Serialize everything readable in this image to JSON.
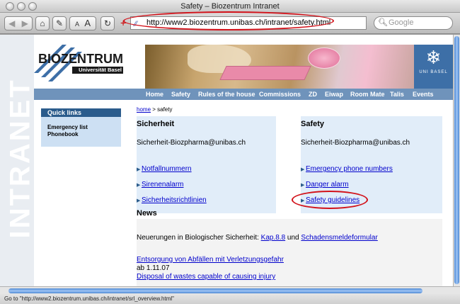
{
  "window": {
    "title": "Safety – Biozentrum Intranet"
  },
  "toolbar": {
    "back_icon": "back-arrow-icon",
    "forward_icon": "forward-arrow-icon",
    "text_smaller": "A",
    "text_bigger": "A",
    "url": "http://www2.biozentrum.unibas.ch/intranet/safety.html",
    "add_bookmark": "+",
    "search_placeholder": "Google"
  },
  "header": {
    "logo_word": "BIOZENTRUM",
    "logo_sub": "Universität Basel",
    "unibas_logo_text": "UNI BASEL",
    "side_text": "INTRANET"
  },
  "nav": {
    "items": [
      "Home",
      "Safety",
      "Rules of the house",
      "Commissions",
      "ZD",
      "Eiwap",
      "Room Mate",
      "Talis",
      "Events"
    ]
  },
  "quick_links": {
    "title": "Quick links",
    "items": [
      "Emergency list",
      "Phonebook"
    ]
  },
  "breadcrumb": {
    "home": "home",
    "rest": " > safety"
  },
  "sicherheit": {
    "title": "Sicherheit",
    "email": "Sicherheit-Biozpharma@unibas.ch",
    "links": [
      "Notfallnummern",
      "Sirenenalarm",
      "Sicherheitsrichtlinien"
    ]
  },
  "safety": {
    "title": "Safety",
    "email": "Sicherheit-Biozpharma@unibas.ch",
    "links": [
      "Emergency phone numbers",
      "Danger alarm",
      "Safety guidelines"
    ]
  },
  "news": {
    "title": "News",
    "line1_prefix": "Neuerungen in Biologischer Sicherheit: ",
    "line1_link1": "Kap.8.8",
    "line1_mid": " und ",
    "line1_link2": "Schadensmeldeformular",
    "item2_link": "Entsorgung von Abfällen mit Verletzungsgefahr",
    "item2_date": "ab 1.11.07",
    "item2_link_en": "Disposal of wastes capable of causing injury"
  },
  "status": {
    "text": "Go to \"http://www2.biozentrum.unibas.ch/intranet/srl_overview.html\""
  },
  "colors": {
    "highlight_oval": "#d2121a",
    "nav_bar": "#6f93bb",
    "link": "#0000cc"
  }
}
